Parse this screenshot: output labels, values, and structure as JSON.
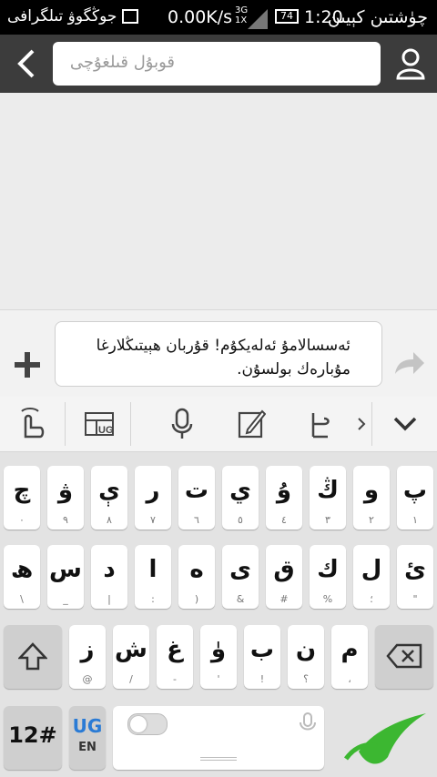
{
  "status_bar": {
    "carrier_left": "چۈشتىن كېيىن",
    "time": "1:20",
    "battery": "74",
    "net_speed": "0.00K/s",
    "network_3g": "3G",
    "network_1x": "1X",
    "notification_app": "جوڭگوۋ تىلگرافى"
  },
  "header": {
    "search_placeholder": "قوبۇل قىلغۇچى"
  },
  "compose": {
    "message_text": "ئەسسالامۇ ئەلەيكۇم! قۇربان ھېيتىڭلارغا مۇبارەك بولسۇن."
  },
  "keyboard": {
    "toolbar": [
      "gesture-icon",
      "layout-icon",
      "mic-icon",
      "edit-icon",
      "settings-icon",
      "more-arrow-icon",
      "hide-keyboard-icon"
    ],
    "row1": [
      {
        "main": "چ",
        "sub": "٠"
      },
      {
        "main": "ۋ",
        "sub": "٩"
      },
      {
        "main": "ې",
        "sub": "٨"
      },
      {
        "main": "ر",
        "sub": "٧"
      },
      {
        "main": "ت",
        "sub": "٦"
      },
      {
        "main": "ي",
        "sub": "٥"
      },
      {
        "main": "ۇ",
        "sub": "٤"
      },
      {
        "main": "ڭ",
        "sub": "٣"
      },
      {
        "main": "و",
        "sub": "٢"
      },
      {
        "main": "پ",
        "sub": "١"
      }
    ],
    "row2": [
      {
        "main": "ھ",
        "sub": "\\"
      },
      {
        "main": "س",
        "sub": "_"
      },
      {
        "main": "د",
        "sub": "|"
      },
      {
        "main": "ا",
        "sub": ":"
      },
      {
        "main": "ە",
        "sub": ")"
      },
      {
        "main": "ى",
        "sub": "&"
      },
      {
        "main": "ق",
        "sub": "#"
      },
      {
        "main": "ك",
        "sub": "%"
      },
      {
        "main": "ل",
        "sub": "؛"
      },
      {
        "main": "ئ",
        "sub": "\""
      }
    ],
    "row3": [
      {
        "main": "ز",
        "sub": "@"
      },
      {
        "main": "ش",
        "sub": "/"
      },
      {
        "main": "غ",
        "sub": "-"
      },
      {
        "main": "ۈ",
        "sub": "'"
      },
      {
        "main": "ب",
        "sub": "!"
      },
      {
        "main": "ن",
        "sub": "؟"
      },
      {
        "main": "م",
        "sub": "،"
      }
    ],
    "symbols_label": "12#",
    "lang_top": "UG",
    "lang_bottom": "EN"
  },
  "colors": {
    "accent_blue": "#2a7bd5",
    "logo_green": "#3cb731"
  }
}
